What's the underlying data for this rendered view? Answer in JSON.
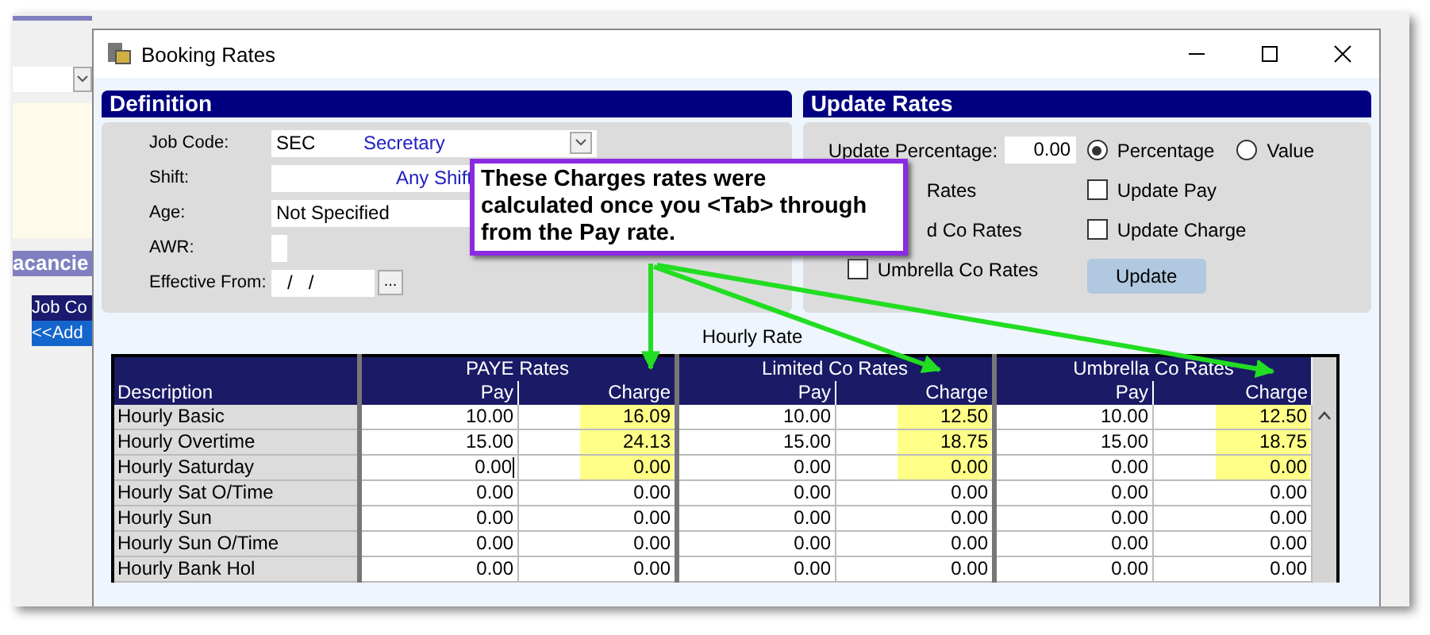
{
  "background_app": {
    "section_title": "acancie",
    "list": [
      {
        "label": "Job Co",
        "selected": false
      },
      {
        "label": "<<Add",
        "selected": true
      }
    ]
  },
  "window": {
    "title": "Booking Rates"
  },
  "definition": {
    "title": "Definition",
    "fields": [
      {
        "kind": "combo",
        "label": "Job Code:",
        "code": "SEC",
        "value": "Secretary"
      },
      {
        "kind": "center",
        "label": "Shift:",
        "value": "Any Shift"
      },
      {
        "kind": "text",
        "label": "Age:",
        "value": "Not Specified"
      },
      {
        "kind": "box",
        "label": "AWR:"
      },
      {
        "kind": "date",
        "label": "Effective From:",
        "value": "/   /",
        "button": "..."
      }
    ]
  },
  "update_rates": {
    "title": "Update Rates",
    "percentage_label": "Update Percentage:",
    "percentage_value": "0.00",
    "modes": [
      {
        "label": "Percentage",
        "selected": true
      },
      {
        "label": "Value",
        "selected": false
      }
    ],
    "rate_options": [
      {
        "kind": "covered",
        "label": "Rates"
      },
      {
        "kind": "covered",
        "label": "d Co Rates"
      },
      {
        "kind": "checkbox",
        "label": "Umbrella Co Rates",
        "checked": false
      }
    ],
    "update_options": [
      {
        "label": "Update Pay",
        "checked": false
      },
      {
        "label": "Update Charge",
        "checked": false
      }
    ],
    "button": "Update"
  },
  "table": {
    "caption": "Hourly Rate",
    "groups": [
      "PAYE Rates",
      "Limited Co Rates",
      "Umbrella Co Rates"
    ],
    "columns": [
      "Description",
      "Pay",
      "Charge",
      "Pay",
      "Charge",
      "Pay",
      "Charge"
    ],
    "rows": [
      {
        "description": "Hourly Basic",
        "values": [
          "10.00",
          "16.09",
          "10.00",
          "12.50",
          "10.00",
          "12.50"
        ],
        "highlighted": true,
        "editing": false
      },
      {
        "description": "Hourly Overtime",
        "values": [
          "15.00",
          "24.13",
          "15.00",
          "18.75",
          "15.00",
          "18.75"
        ],
        "highlighted": true,
        "editing": false
      },
      {
        "description": "Hourly Saturday",
        "values": [
          "0.00",
          "0.00",
          "0.00",
          "0.00",
          "0.00",
          "0.00"
        ],
        "highlighted": true,
        "editing": true
      },
      {
        "description": "Hourly Sat O/Time",
        "values": [
          "0.00",
          "0.00",
          "0.00",
          "0.00",
          "0.00",
          "0.00"
        ],
        "highlighted": false,
        "editing": false
      },
      {
        "description": "Hourly Sun",
        "values": [
          "0.00",
          "0.00",
          "0.00",
          "0.00",
          "0.00",
          "0.00"
        ],
        "highlighted": false,
        "editing": false
      },
      {
        "description": "Hourly Sun O/Time",
        "values": [
          "0.00",
          "0.00",
          "0.00",
          "0.00",
          "0.00",
          "0.00"
        ],
        "highlighted": false,
        "editing": false
      },
      {
        "description": "Hourly Bank Hol",
        "values": [
          "0.00",
          "0.00",
          "0.00",
          "0.00",
          "0.00",
          "0.00"
        ],
        "highlighted": false,
        "editing": false
      }
    ]
  },
  "callout": {
    "text": "These Charges rates were\ncalculated once you <Tab> through\nfrom the Pay rate."
  }
}
